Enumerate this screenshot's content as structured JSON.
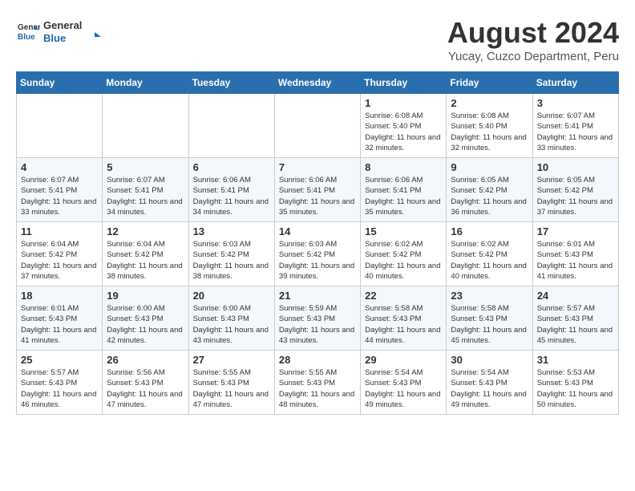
{
  "header": {
    "logo_general": "General",
    "logo_blue": "Blue",
    "month_year": "August 2024",
    "location": "Yucay, Cuzco Department, Peru"
  },
  "days_of_week": [
    "Sunday",
    "Monday",
    "Tuesday",
    "Wednesday",
    "Thursday",
    "Friday",
    "Saturday"
  ],
  "weeks": [
    [
      {
        "day": "",
        "info": ""
      },
      {
        "day": "",
        "info": ""
      },
      {
        "day": "",
        "info": ""
      },
      {
        "day": "",
        "info": ""
      },
      {
        "day": "1",
        "info": "Sunrise: 6:08 AM\nSunset: 5:40 PM\nDaylight: 11 hours\nand 32 minutes."
      },
      {
        "day": "2",
        "info": "Sunrise: 6:08 AM\nSunset: 5:40 PM\nDaylight: 11 hours\nand 32 minutes."
      },
      {
        "day": "3",
        "info": "Sunrise: 6:07 AM\nSunset: 5:41 PM\nDaylight: 11 hours\nand 33 minutes."
      }
    ],
    [
      {
        "day": "4",
        "info": "Sunrise: 6:07 AM\nSunset: 5:41 PM\nDaylight: 11 hours\nand 33 minutes."
      },
      {
        "day": "5",
        "info": "Sunrise: 6:07 AM\nSunset: 5:41 PM\nDaylight: 11 hours\nand 34 minutes."
      },
      {
        "day": "6",
        "info": "Sunrise: 6:06 AM\nSunset: 5:41 PM\nDaylight: 11 hours\nand 34 minutes."
      },
      {
        "day": "7",
        "info": "Sunrise: 6:06 AM\nSunset: 5:41 PM\nDaylight: 11 hours\nand 35 minutes."
      },
      {
        "day": "8",
        "info": "Sunrise: 6:06 AM\nSunset: 5:41 PM\nDaylight: 11 hours\nand 35 minutes."
      },
      {
        "day": "9",
        "info": "Sunrise: 6:05 AM\nSunset: 5:42 PM\nDaylight: 11 hours\nand 36 minutes."
      },
      {
        "day": "10",
        "info": "Sunrise: 6:05 AM\nSunset: 5:42 PM\nDaylight: 11 hours\nand 37 minutes."
      }
    ],
    [
      {
        "day": "11",
        "info": "Sunrise: 6:04 AM\nSunset: 5:42 PM\nDaylight: 11 hours\nand 37 minutes."
      },
      {
        "day": "12",
        "info": "Sunrise: 6:04 AM\nSunset: 5:42 PM\nDaylight: 11 hours\nand 38 minutes."
      },
      {
        "day": "13",
        "info": "Sunrise: 6:03 AM\nSunset: 5:42 PM\nDaylight: 11 hours\nand 38 minutes."
      },
      {
        "day": "14",
        "info": "Sunrise: 6:03 AM\nSunset: 5:42 PM\nDaylight: 11 hours\nand 39 minutes."
      },
      {
        "day": "15",
        "info": "Sunrise: 6:02 AM\nSunset: 5:42 PM\nDaylight: 11 hours\nand 40 minutes."
      },
      {
        "day": "16",
        "info": "Sunrise: 6:02 AM\nSunset: 5:42 PM\nDaylight: 11 hours\nand 40 minutes."
      },
      {
        "day": "17",
        "info": "Sunrise: 6:01 AM\nSunset: 5:43 PM\nDaylight: 11 hours\nand 41 minutes."
      }
    ],
    [
      {
        "day": "18",
        "info": "Sunrise: 6:01 AM\nSunset: 5:43 PM\nDaylight: 11 hours\nand 41 minutes."
      },
      {
        "day": "19",
        "info": "Sunrise: 6:00 AM\nSunset: 5:43 PM\nDaylight: 11 hours\nand 42 minutes."
      },
      {
        "day": "20",
        "info": "Sunrise: 6:00 AM\nSunset: 5:43 PM\nDaylight: 11 hours\nand 43 minutes."
      },
      {
        "day": "21",
        "info": "Sunrise: 5:59 AM\nSunset: 5:43 PM\nDaylight: 11 hours\nand 43 minutes."
      },
      {
        "day": "22",
        "info": "Sunrise: 5:58 AM\nSunset: 5:43 PM\nDaylight: 11 hours\nand 44 minutes."
      },
      {
        "day": "23",
        "info": "Sunrise: 5:58 AM\nSunset: 5:43 PM\nDaylight: 11 hours\nand 45 minutes."
      },
      {
        "day": "24",
        "info": "Sunrise: 5:57 AM\nSunset: 5:43 PM\nDaylight: 11 hours\nand 45 minutes."
      }
    ],
    [
      {
        "day": "25",
        "info": "Sunrise: 5:57 AM\nSunset: 5:43 PM\nDaylight: 11 hours\nand 46 minutes."
      },
      {
        "day": "26",
        "info": "Sunrise: 5:56 AM\nSunset: 5:43 PM\nDaylight: 11 hours\nand 47 minutes."
      },
      {
        "day": "27",
        "info": "Sunrise: 5:55 AM\nSunset: 5:43 PM\nDaylight: 11 hours\nand 47 minutes."
      },
      {
        "day": "28",
        "info": "Sunrise: 5:55 AM\nSunset: 5:43 PM\nDaylight: 11 hours\nand 48 minutes."
      },
      {
        "day": "29",
        "info": "Sunrise: 5:54 AM\nSunset: 5:43 PM\nDaylight: 11 hours\nand 49 minutes."
      },
      {
        "day": "30",
        "info": "Sunrise: 5:54 AM\nSunset: 5:43 PM\nDaylight: 11 hours\nand 49 minutes."
      },
      {
        "day": "31",
        "info": "Sunrise: 5:53 AM\nSunset: 5:43 PM\nDaylight: 11 hours\nand 50 minutes."
      }
    ]
  ]
}
